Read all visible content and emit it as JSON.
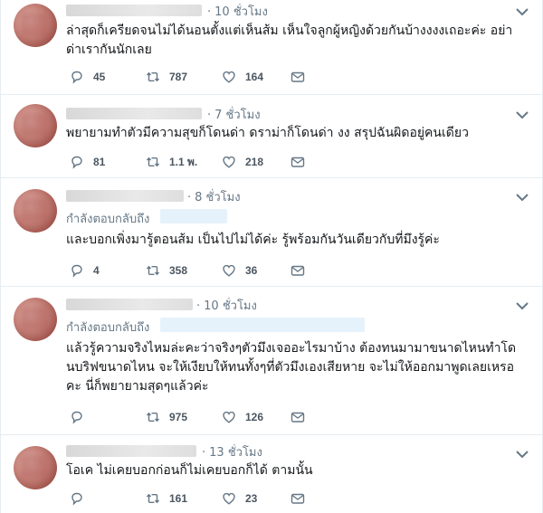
{
  "colors": {
    "text": "#14171a",
    "muted": "#657786",
    "divider": "#e6ecf0",
    "handle_highlight": "#e5f2fb"
  },
  "icons": {
    "reply": "reply-icon",
    "retweet": "retweet-icon",
    "like": "heart-icon",
    "dm": "envelope-icon",
    "caret": "chevron-down-icon"
  },
  "tweets": [
    {
      "time": "10 ชั่วโมง",
      "text": "ล่าสุดก็เครียดจนไม่ได้นอนตั้งแต่เห็นส้ม เห็นใจลูกผู้หญิงด้วยกันบ้างงงงเถอะค่ะ อย่าด่าเรากันนักเลย",
      "replying_to": "",
      "replies": "45",
      "retweets": "787",
      "likes": "164"
    },
    {
      "time": "7 ชั่วโมง",
      "text": "พยายามทำตัวมีความสุขก็โดนด่า ดราม่าก็โดนด่า งง สรุปฉันผิดอยู่คนเดียว",
      "replying_to": "",
      "replies": "81",
      "retweets": "1.1 พ.",
      "likes": "218"
    },
    {
      "time": "8 ชั่วโมง",
      "text": "และบอกเพิ่งมารู้ตอนส้ม เป็นไปไม่ได้ค่ะ รู้พร้อมกันวันเดียวกับที่มึงรู้ค่ะ",
      "replying_to": "กำลังตอบกลับถึง",
      "replies": "4",
      "retweets": "358",
      "likes": "36"
    },
    {
      "time": "10 ชั่วโมง",
      "text": "แล้วรู้ความจริงไหมล่ะคะว่าจริงๆตัวมึงเจออะไรมาบ้าง ต้องทนมามาขนาดไหนทำโดนบริฟขนาดไหน จะให้เงียบให้ทนทั้งๆที่ตัวมึงเองเสียหาย จะไม่ให้ออกมาพูดเลยเหรอคะ นี่ก็พยายามสุดๆแล้วค่ะ",
      "replying_to": "กำลังตอบกลับถึง",
      "replies": "",
      "retweets": "975",
      "likes": "126"
    },
    {
      "time": "13 ชั่วโมง",
      "text": "โอเค ไม่เคยบอกก่อนก็ไม่เคยบอกก็ได้ ตามนั้น",
      "replying_to": "",
      "replies": "",
      "retweets": "161",
      "likes": "23"
    }
  ]
}
